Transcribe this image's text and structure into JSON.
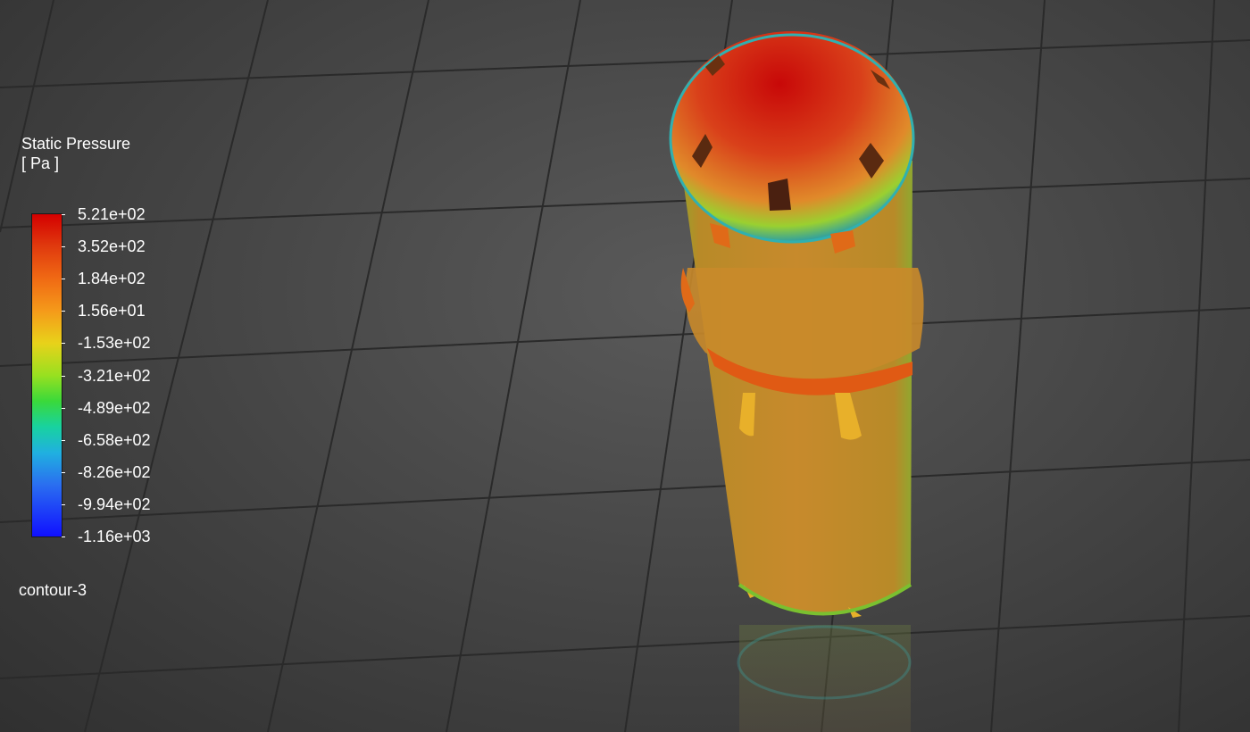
{
  "legend": {
    "title": "Static Pressure",
    "unit": "[ Pa ]",
    "ticks": [
      "5.21e+02",
      "3.52e+02",
      "1.84e+02",
      "1.56e+01",
      "-1.53e+02",
      "-3.21e+02",
      "-4.89e+02",
      "-6.58e+02",
      "-8.26e+02",
      "-9.94e+02",
      "-1.16e+03"
    ],
    "colormap": [
      "#d40000",
      "#f06a14",
      "#e8d21a",
      "#3ad93a",
      "#20b0e0",
      "#1010ff"
    ]
  },
  "contour_name": "contour-3",
  "scene": {
    "background": "#474747",
    "grid_color": "#2a2a2a",
    "body_color": "#c88a2a",
    "cap_color": "#c80808"
  }
}
